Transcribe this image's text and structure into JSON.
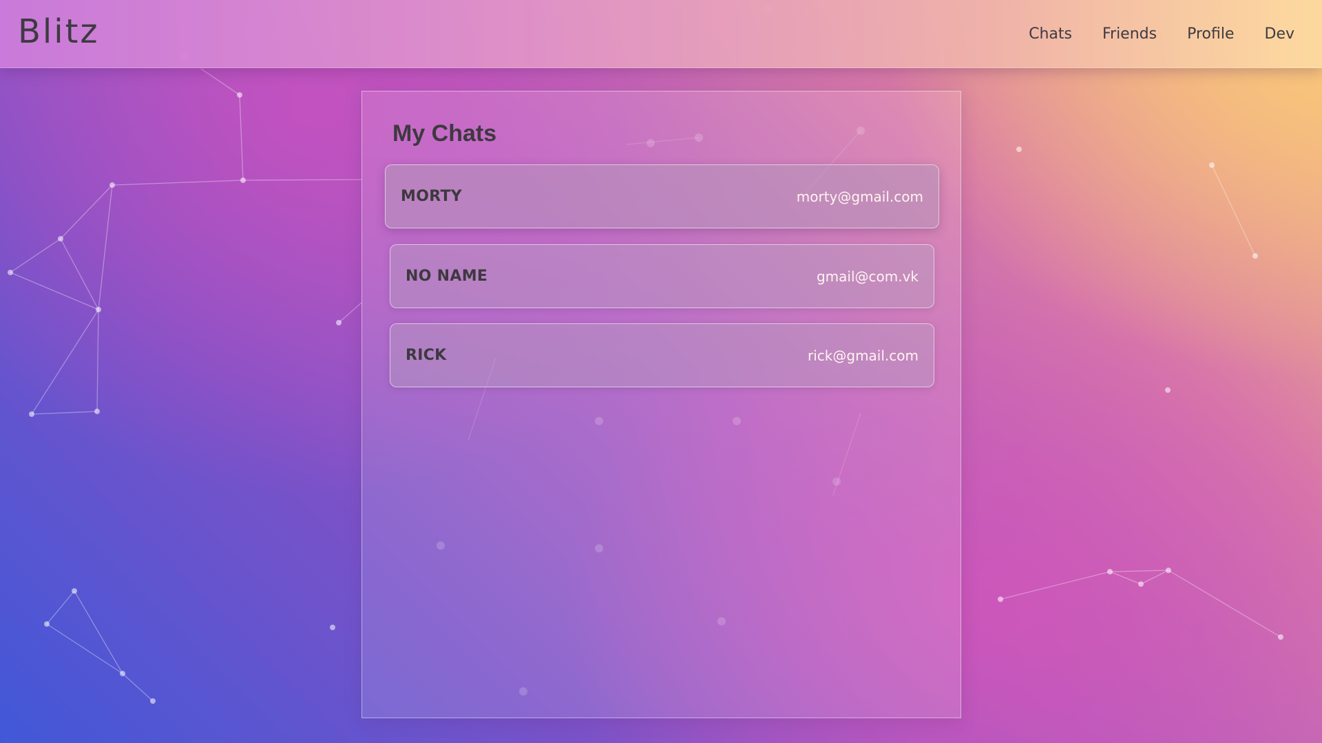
{
  "app": {
    "logo": "Blitz"
  },
  "nav": [
    {
      "label": "Chats"
    },
    {
      "label": "Friends"
    },
    {
      "label": "Profile"
    },
    {
      "label": "Dev"
    }
  ],
  "main": {
    "title": "My Chats",
    "chats": [
      {
        "name": "MORTY",
        "email": "morty@gmail.com"
      },
      {
        "name": "NO NAME",
        "email": "gmail@com.vk"
      },
      {
        "name": "RICK",
        "email": "rick@gmail.com"
      }
    ]
  }
}
